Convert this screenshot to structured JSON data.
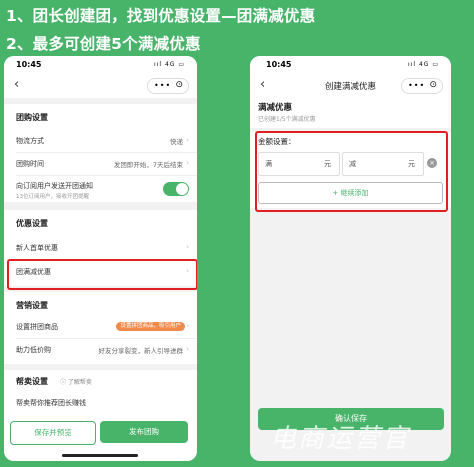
{
  "captions": {
    "line1": "1、团长创建团，找到优惠设置—团满减优惠",
    "line2": "2、最多可创建5个满减优惠"
  },
  "phone1": {
    "status_time": "10:45",
    "status_right": "ııl 4G ▭",
    "capsule_dots": "•••",
    "capsule_circle": "⊙",
    "back": "‹",
    "group_settings": {
      "title": "团购设置",
      "logistics_label": "物流方式",
      "logistics_value": "快递",
      "time_label": "团购时间",
      "time_value": "发团即开始，7天后结束",
      "notify_label": "向订阅用户发送开团通知",
      "notify_desc": "13位订阅用户，接收开团提醒"
    },
    "promo": {
      "title": "优惠设置",
      "first_order": "新人首单优惠",
      "full_reduction": "团满减优惠"
    },
    "marketing": {
      "title": "营销设置",
      "pintuan_label": "设置拼团商品",
      "pintuan_tag": "设置拼团商品，吸引用户",
      "help_label": "助力低价购",
      "help_value": "好友分享裂变，新人引导进群"
    },
    "help_sale": {
      "title": "帮卖设置",
      "link": "ⓘ 了解帮卖",
      "partial": "帮卖帮你推荐团长赚钱"
    },
    "buttons": {
      "save_preview": "保存并预览",
      "publish": "发布团购"
    }
  },
  "phone2": {
    "status_time": "10:45",
    "status_right": "ııl 4G ▭",
    "back": "‹",
    "nav_title": "创建满减优惠",
    "capsule_dots": "•••",
    "capsule_circle": "⊙",
    "section_title": "满减优惠",
    "created_count": "已创建1/5个满减优惠",
    "amount_label": "金额设置：",
    "full_prefix": "满",
    "full_unit": "元",
    "minus_prefix": "减",
    "minus_unit": "元",
    "delete": "×",
    "add_more": "+ 继续添加",
    "confirm": "确认保存"
  },
  "watermark": "电商运营官",
  "colors": {
    "background": "#47b46a",
    "accent": "#47b46a",
    "highlight": "#e02020"
  }
}
